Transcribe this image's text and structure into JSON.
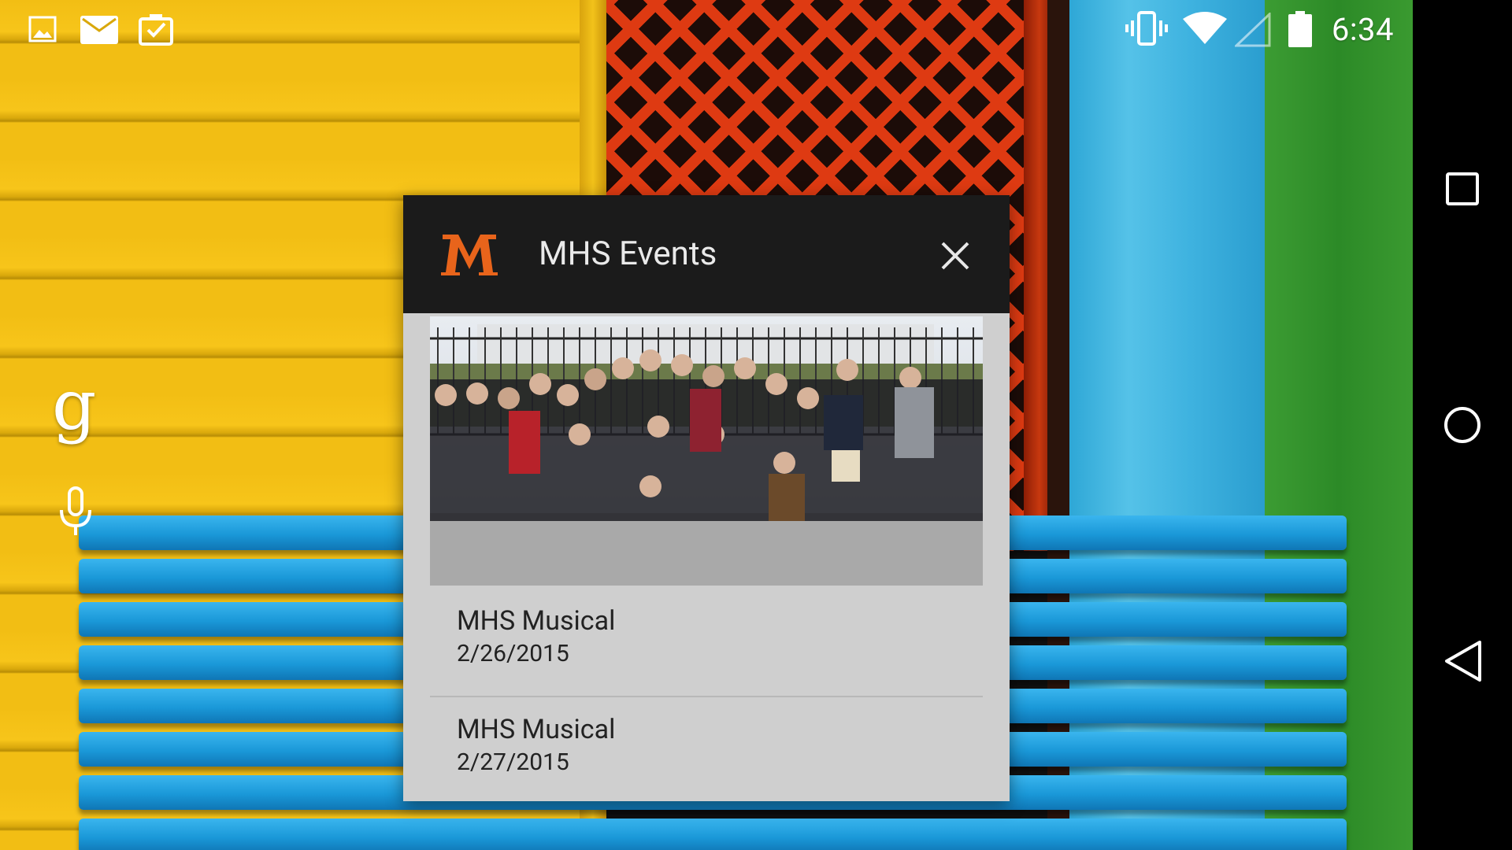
{
  "status_bar": {
    "time": "6:34",
    "icons": [
      "picture-icon",
      "mail-icon",
      "clipboard-check-icon",
      "vibrate-icon",
      "wifi-icon",
      "signal-empty-icon",
      "battery-icon"
    ]
  },
  "home": {
    "search_icon": "g",
    "voice_icon": "mic-icon"
  },
  "widget": {
    "title": "MHS Events",
    "logo_letter": "M",
    "accent_color": "#e8641b",
    "events": [
      {
        "title": "MHS Musical",
        "date": "2/26/2015"
      },
      {
        "title": "MHS Musical",
        "date": "2/27/2015"
      }
    ]
  },
  "nav_bar": {
    "buttons": [
      "recents-square-icon",
      "home-circle-icon",
      "back-triangle-icon"
    ]
  }
}
